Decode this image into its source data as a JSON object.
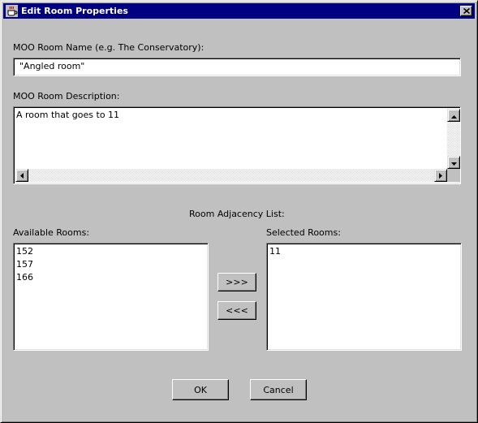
{
  "window": {
    "title": "Edit Room Properties",
    "title_icon": "java-cup-icon",
    "close_icon": "close-icon"
  },
  "room_name": {
    "label": "MOO Room Name (e.g. The Conservatory):",
    "value": "\"Angled room\""
  },
  "room_description": {
    "label": "MOO Room Description:",
    "value": "A room that goes to 11"
  },
  "adjacency": {
    "heading": "Room Adjacency List:",
    "available_label": "Available Rooms:",
    "available_rooms": [
      "152",
      "157",
      "166"
    ],
    "selected_label": "Selected Rooms:",
    "selected_rooms": [
      "11"
    ],
    "add_label": ">>>",
    "remove_label": "<<<"
  },
  "buttons": {
    "ok": "OK",
    "cancel": "Cancel"
  },
  "colors": {
    "titlebar": "#000080",
    "face": "#c0c0c0"
  }
}
